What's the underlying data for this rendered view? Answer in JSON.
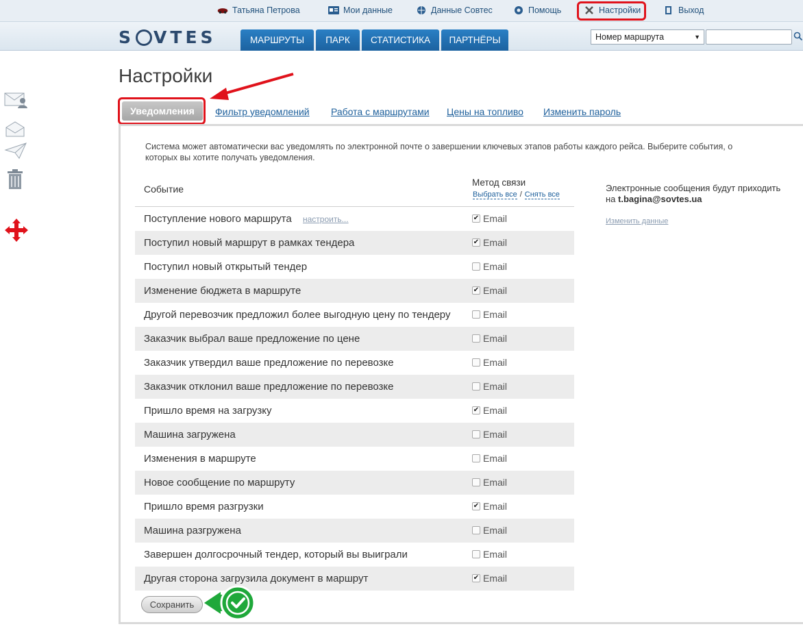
{
  "topbar": {
    "user_name": "Татьяна Петрова",
    "my_data": "Мои данные",
    "sovtes_data": "Данные Совтес",
    "help": "Помощь",
    "settings": "Настройки",
    "logout": "Выход"
  },
  "navbar": {
    "logo": [
      "S",
      "V",
      "T",
      "E",
      "S"
    ],
    "tabs": [
      "МАРШРУТЫ",
      "ПАРК",
      "СТАТИСТИКА",
      "ПАРТНЁРЫ"
    ],
    "route_select_value": "Номер маршрута",
    "search_value": ""
  },
  "page": {
    "title": "Настройки",
    "subtabs": {
      "active": "Уведомления",
      "others": [
        "Фильтр уведомлений",
        "Работа с маршрутами",
        "Цены на топливо",
        "Изменить пароль"
      ]
    }
  },
  "notifications": {
    "intro": "Система может автоматически вас уведомлять по электронной почте о завершении ключевых этапов работы каждого рейса. Выберите события, о которых вы хотите получать уведомления.",
    "header_event": "Событие",
    "header_method": "Метод связи",
    "select_all": "Выбрать все",
    "separator": "/",
    "deselect_all": "Снять все",
    "configure_link": "настроить...",
    "checkbox_label": "Email",
    "rows": [
      {
        "event": "Поступление нового маршрута",
        "checked": true
      },
      {
        "event": "Поступил новый маршрут в рамках тендера",
        "checked": true
      },
      {
        "event": "Поступил новый открытый тендер",
        "checked": false
      },
      {
        "event": "Изменение бюджета в маршруте",
        "checked": true
      },
      {
        "event": "Другой перевозчик предложил более выгодную цену по тендеру",
        "checked": false
      },
      {
        "event": "Заказчик выбрал ваше предложение по цене",
        "checked": false
      },
      {
        "event": "Заказчик утвердил ваше предложение по перевозке",
        "checked": false
      },
      {
        "event": "Заказчик отклонил ваше предложение по перевозке",
        "checked": false
      },
      {
        "event": "Пришло время на загрузку",
        "checked": true
      },
      {
        "event": "Машина загружена",
        "checked": false
      },
      {
        "event": "Изменения в маршруте",
        "checked": false
      },
      {
        "event": "Новое сообщение по маршруту",
        "checked": false
      },
      {
        "event": "Пришло время разгрузки",
        "checked": true
      },
      {
        "event": "Машина разгружена",
        "checked": false
      },
      {
        "event": "Завершен долгосрочный тендер, который вы выиграли",
        "checked": false
      },
      {
        "event": "Другая сторона загрузила документ в маршрут",
        "checked": true
      }
    ],
    "info_text": "Электронные сообщения будут приходить на",
    "info_email": "t.bagina@sovtes.ua",
    "change_data": "Изменить данные",
    "save_button": "Сохранить"
  },
  "colors": {
    "nav_blue": "#1c62a0",
    "highlight_red": "#e0121b",
    "check_green": "#1fa83a"
  }
}
